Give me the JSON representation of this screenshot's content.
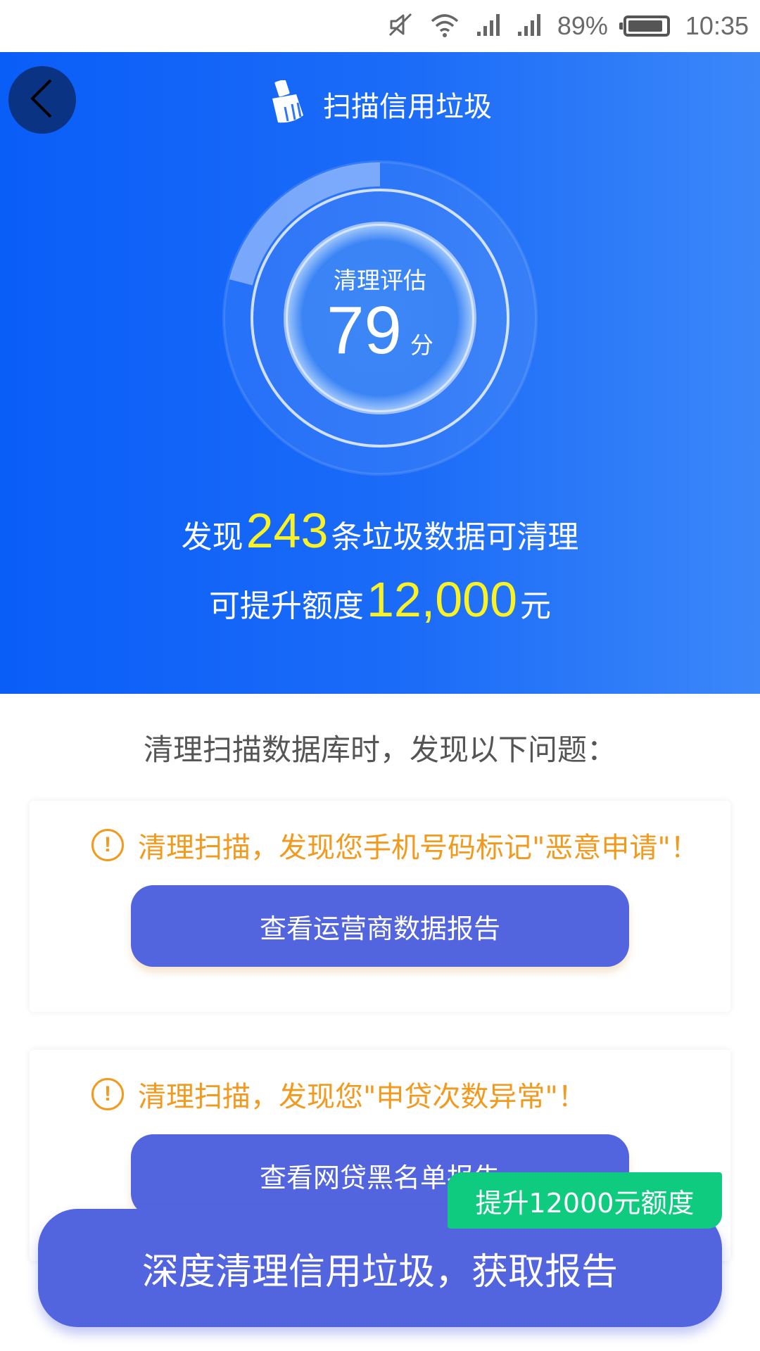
{
  "status_bar": {
    "battery": "89%",
    "time": "10:35",
    "icons": [
      "mute-icon",
      "wifi-icon",
      "signal-icon",
      "signal-icon",
      "battery-icon"
    ]
  },
  "header": {
    "title": "扫描信用垃圾",
    "title_icon": "broom-icon",
    "back_icon": "chevron-left-icon"
  },
  "gauge": {
    "label": "清理评估",
    "score": "79",
    "unit": "分",
    "max_score": 100
  },
  "summary": {
    "found_prefix": "发现",
    "found_count": "243",
    "found_suffix": "条垃圾数据可清理",
    "raise_prefix": "可提升额度",
    "raise_amount": "12,000",
    "raise_suffix": "元"
  },
  "problems": {
    "title": "清理扫描数据库时，发现以下问题：",
    "items": [
      {
        "warning": "清理扫描，发现您手机号码标记\"恶意申请\"！",
        "button": "查看运营商数据报告"
      },
      {
        "warning": "清理扫描，发现您\"申贷次数异常\"！",
        "button": "查看网贷黑名单报告"
      }
    ]
  },
  "cta": {
    "label": "深度清理信用垃圾，获取报告",
    "badge": "提升12000元额度"
  },
  "colors": {
    "hero_start": "#0a5ef8",
    "hero_end": "#3b87f9",
    "highlight": "#f9f326",
    "warning": "#f19a1d",
    "button": "#5364df",
    "badge": "#0fcb7f"
  }
}
